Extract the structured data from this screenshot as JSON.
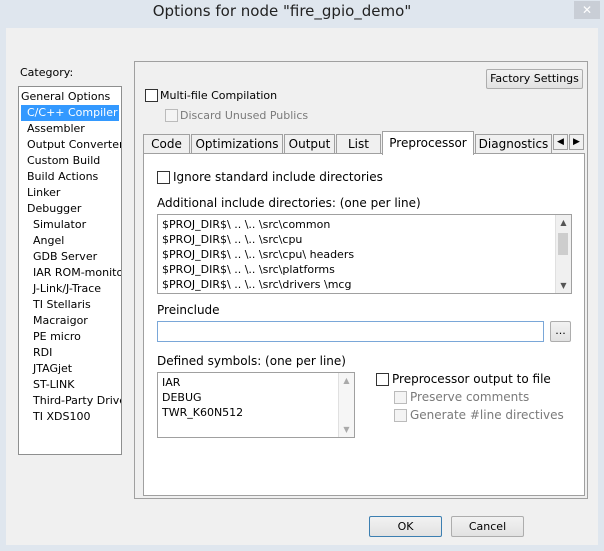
{
  "window": {
    "title": "Options for node \"fire_gpio_demo\"",
    "close_glyph": "✕"
  },
  "category": {
    "label": "Category:",
    "items": [
      {
        "label": "General Options",
        "indent": false
      },
      {
        "label": "C/C++ Compiler",
        "indent": false,
        "selected": true
      },
      {
        "label": "Assembler",
        "indent": false
      },
      {
        "label": "Output Converter",
        "indent": false
      },
      {
        "label": "Custom Build",
        "indent": false
      },
      {
        "label": "Build Actions",
        "indent": false
      },
      {
        "label": "Linker",
        "indent": false
      },
      {
        "label": "Debugger",
        "indent": false
      },
      {
        "label": "Simulator",
        "indent": true
      },
      {
        "label": "Angel",
        "indent": true
      },
      {
        "label": "GDB Server",
        "indent": true
      },
      {
        "label": "IAR ROM-monitor",
        "indent": true
      },
      {
        "label": "J-Link/J-Trace",
        "indent": true
      },
      {
        "label": "TI Stellaris",
        "indent": true
      },
      {
        "label": "Macraigor",
        "indent": true
      },
      {
        "label": "PE micro",
        "indent": true
      },
      {
        "label": "RDI",
        "indent": true
      },
      {
        "label": "JTAGjet",
        "indent": true
      },
      {
        "label": "ST-LINK",
        "indent": true
      },
      {
        "label": "Third-Party Driver",
        "indent": true
      },
      {
        "label": "TI XDS100",
        "indent": true
      }
    ]
  },
  "header": {
    "factory_settings": "Factory Settings",
    "multi_file": "Multi-file Compilation",
    "discard_unused": "Discard Unused Publics"
  },
  "tabs": [
    "Code",
    "Optimizations",
    "Output",
    "List",
    "Preprocessor",
    "Diagnostics"
  ],
  "active_tab": "Preprocessor",
  "scroll_glyphs": {
    "left": "◀",
    "right": "▶",
    "up": "▲",
    "down": "▼"
  },
  "preprocessor": {
    "ignore_std": "Ignore standard include directories",
    "include_label": "Additional include directories: (one per line)",
    "include_dirs": [
      "$PROJ_DIR$\\ .. \\.. \\src\\common",
      "$PROJ_DIR$\\ .. \\.. \\src\\cpu",
      "$PROJ_DIR$\\ .. \\.. \\src\\cpu\\ headers",
      "$PROJ_DIR$\\ .. \\.. \\src\\platforms",
      "$PROJ_DIR$\\ .. \\.. \\src\\drivers \\mcg"
    ],
    "preinclude_label": "Preinclude",
    "preinclude_value": "",
    "browse_label": "...",
    "defined_label": "Defined symbols: (one per line)",
    "defined_symbols": [
      "IAR",
      "DEBUG",
      "TWR_K60N512"
    ],
    "pp_output": "Preprocessor output to file",
    "preserve_comments": "Preserve comments",
    "generate_line": "Generate #line directives"
  },
  "footer": {
    "ok": "OK",
    "cancel": "Cancel"
  }
}
